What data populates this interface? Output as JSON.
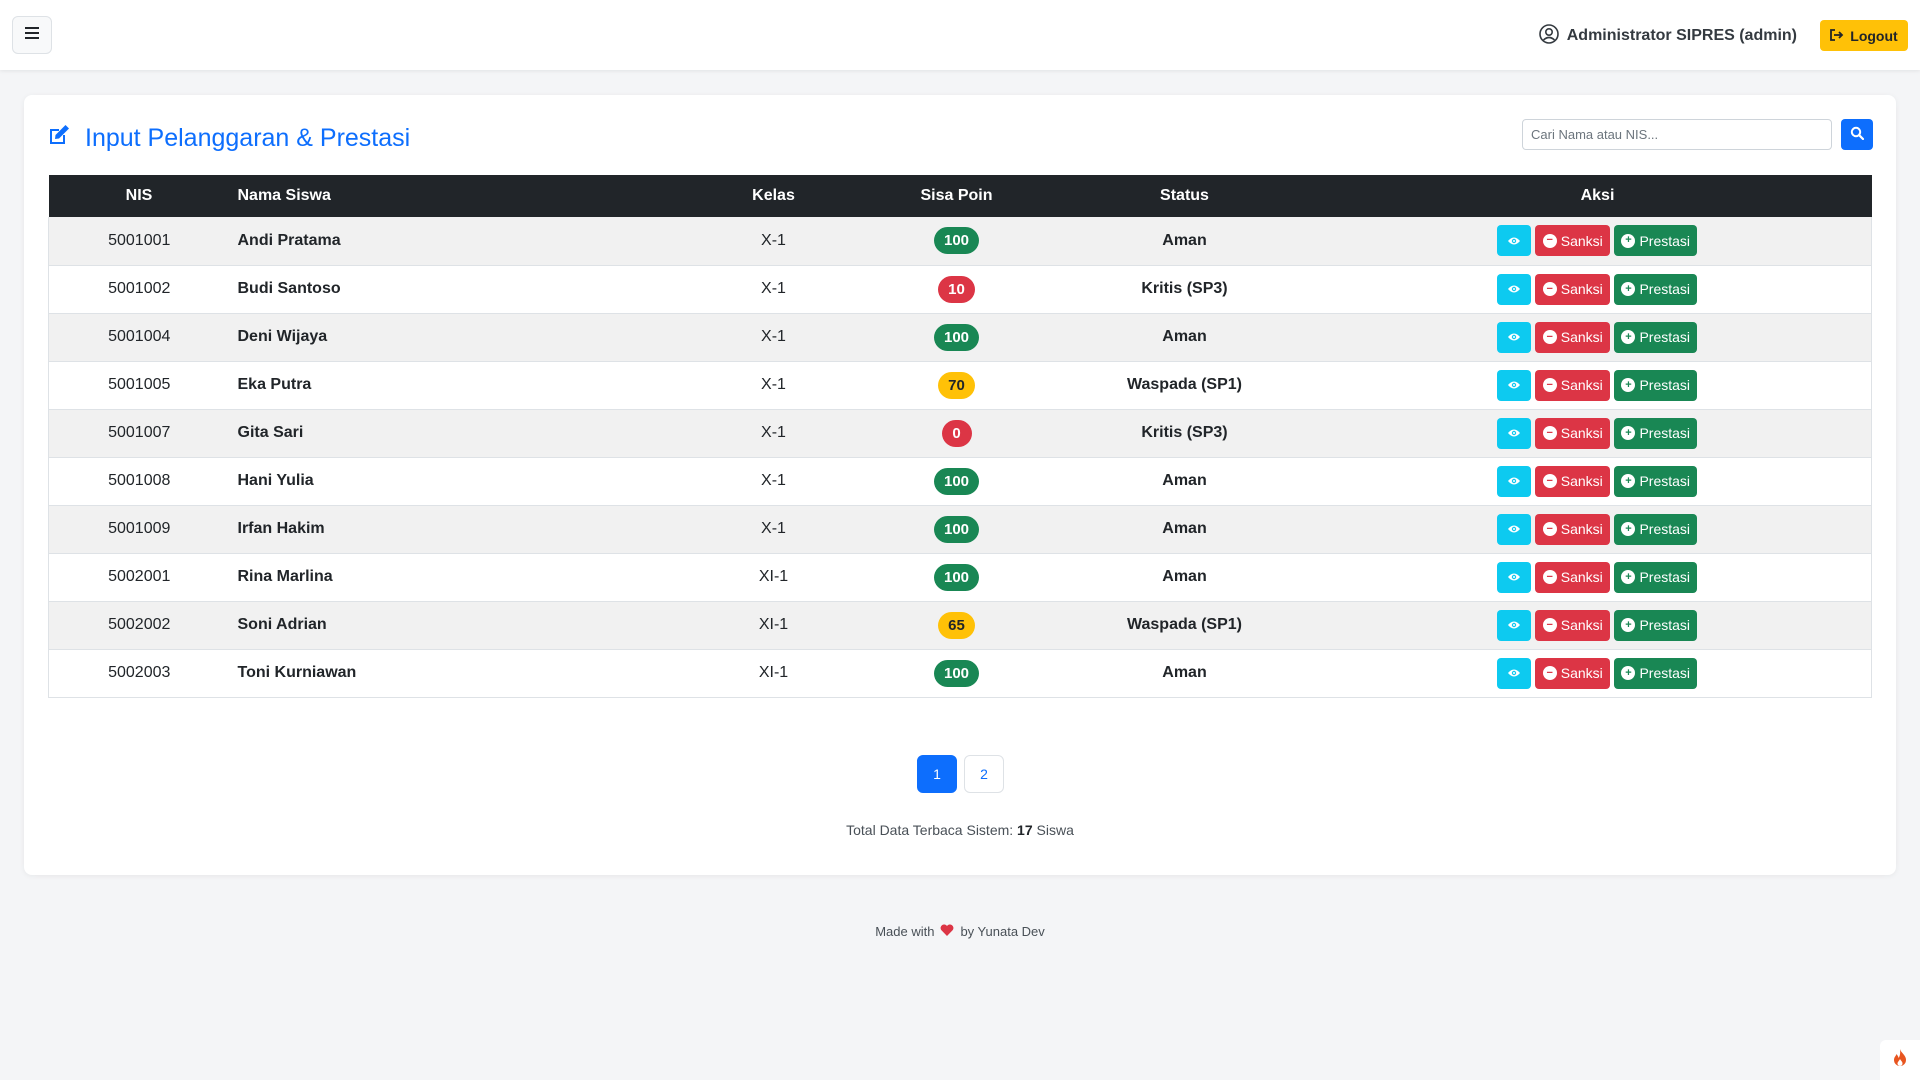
{
  "navbar": {
    "user_label": "Administrator SIPRES (admin)",
    "logout_label": "Logout"
  },
  "page": {
    "title": "Input Pelanggaran & Prestasi",
    "search_placeholder": "Cari Nama atau NIS..."
  },
  "table": {
    "headers": [
      "NIS",
      "Nama Siswa",
      "Kelas",
      "Sisa Poin",
      "Status",
      "Aksi"
    ],
    "action_labels": {
      "sanksi": "Sanksi",
      "prestasi": "Prestasi"
    },
    "rows": [
      {
        "nis": "5001001",
        "nama": "Andi Pratama",
        "kelas": "X-1",
        "poin": "100",
        "poin_level": "success",
        "status": "Aman"
      },
      {
        "nis": "5001002",
        "nama": "Budi Santoso",
        "kelas": "X-1",
        "poin": "10",
        "poin_level": "danger",
        "status": "Kritis (SP3)"
      },
      {
        "nis": "5001004",
        "nama": "Deni Wijaya",
        "kelas": "X-1",
        "poin": "100",
        "poin_level": "success",
        "status": "Aman"
      },
      {
        "nis": "5001005",
        "nama": "Eka Putra",
        "kelas": "X-1",
        "poin": "70",
        "poin_level": "warning",
        "status": "Waspada (SP1)"
      },
      {
        "nis": "5001007",
        "nama": "Gita Sari",
        "kelas": "X-1",
        "poin": "0",
        "poin_level": "danger",
        "status": "Kritis (SP3)"
      },
      {
        "nis": "5001008",
        "nama": "Hani Yulia",
        "kelas": "X-1",
        "poin": "100",
        "poin_level": "success",
        "status": "Aman"
      },
      {
        "nis": "5001009",
        "nama": "Irfan Hakim",
        "kelas": "X-1",
        "poin": "100",
        "poin_level": "success",
        "status": "Aman"
      },
      {
        "nis": "5002001",
        "nama": "Rina Marlina",
        "kelas": "XI-1",
        "poin": "100",
        "poin_level": "success",
        "status": "Aman"
      },
      {
        "nis": "5002002",
        "nama": "Soni Adrian",
        "kelas": "XI-1",
        "poin": "65",
        "poin_level": "warning",
        "status": "Waspada (SP1)"
      },
      {
        "nis": "5002003",
        "nama": "Toni Kurniawan",
        "kelas": "XI-1",
        "poin": "100",
        "poin_level": "success",
        "status": "Aman"
      }
    ]
  },
  "pagination": {
    "pages": [
      "1",
      "2"
    ],
    "active": "1"
  },
  "summary": {
    "prefix": "Total Data Terbaca Sistem:",
    "count": "17",
    "suffix": "Siswa"
  },
  "footer": {
    "before": "Made with",
    "after": "by Yunata Dev"
  },
  "colors": {
    "primary": "#0d6efd",
    "success": "#198754",
    "danger": "#dc3545",
    "warning": "#ffc107",
    "info": "#0dcaf0",
    "dark": "#212529"
  },
  "icons": [
    "hamburger-menu-icon",
    "user-circle-icon",
    "logout-icon",
    "edit-icon",
    "search-icon",
    "eye-icon",
    "minus-circle-icon",
    "plus-circle-icon",
    "heart-icon",
    "fire-icon"
  ]
}
